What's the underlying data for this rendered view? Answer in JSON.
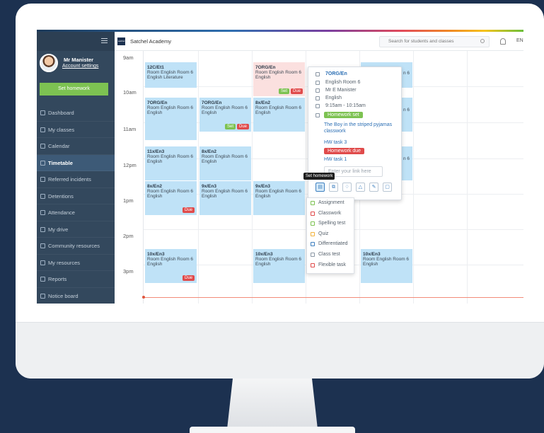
{
  "app": {
    "school": "Satchel Academy",
    "logo_text": "satchel",
    "lang": "EN"
  },
  "search": {
    "placeholder": "Search for students and classes"
  },
  "sidebar": {
    "user_name": "Mr Manister",
    "account_link": "Account settings",
    "set_homework": "Set homework",
    "items": [
      {
        "label": "Dashboard"
      },
      {
        "label": "My classes"
      },
      {
        "label": "Calendar"
      },
      {
        "label": "Timetable"
      },
      {
        "label": "Referred incidents"
      },
      {
        "label": "Detentions"
      },
      {
        "label": "Attendance"
      },
      {
        "label": "My drive"
      },
      {
        "label": "Community resources"
      },
      {
        "label": "My resources"
      },
      {
        "label": "Reports"
      },
      {
        "label": "Notice board"
      }
    ],
    "active_index": 3
  },
  "times": [
    "9am",
    "10am",
    "11am",
    "12pm",
    "1pm",
    "2pm",
    "3pm"
  ],
  "lessons": [
    {
      "title": "12C/Et1",
      "room": "Room English Room 6",
      "subject": "English Literature"
    },
    {
      "title": "7ORG/En",
      "room": "Room English Room 6",
      "subject": "English",
      "set": "Set",
      "due": "Due"
    },
    {
      "title": "7ORG/En",
      "room": "Room English Room 6",
      "subject": "English"
    },
    {
      "title": "7ORG/En",
      "room": "Room English Room 6",
      "subject": "English",
      "set": "Set",
      "due": "Due"
    },
    {
      "title": "8x/En2",
      "room": "Room English Room 6",
      "subject": "English"
    },
    {
      "title": "11x/En3",
      "room": "Room English Room 6",
      "subject": "English"
    },
    {
      "title": "8x/En2",
      "room": "Room English Room 6",
      "subject": "English"
    },
    {
      "title": "8x/En2",
      "room": "Room English Room 6",
      "subject": "English",
      "due": "Due"
    },
    {
      "title": "9x/En3",
      "room": "Room English Room 6",
      "subject": "English"
    },
    {
      "title": "9x/En3",
      "room": "Room English Room 6",
      "subject": "English"
    },
    {
      "title": "10x/En3",
      "room": "Room English Room 6",
      "subject": "English",
      "due": "Due"
    },
    {
      "title": "10x/En3",
      "room": "Room English Room 6",
      "subject": "English"
    },
    {
      "title": "10x/En3",
      "room": "Room English Room 6",
      "subject": "English"
    }
  ],
  "side_frag": {
    "a": "n 6",
    "b": "n 6",
    "c": "n 6"
  },
  "popup": {
    "title": "7ORG/En",
    "room": "English Room 6",
    "teacher": "Mr E Manister",
    "subject": "English",
    "time": "9:15am - 10:15am",
    "hw_set": "Homework set",
    "hw_set_title": "The Boy in the striped pyjamas classwork",
    "task3": "HW task 3",
    "hw_due": "Homework due",
    "task1": "HW task 1",
    "link_placeholder": "Enter your link here"
  },
  "tooltip": "Set homework",
  "menu": [
    "Assignment",
    "Classwork",
    "Spelling test",
    "Quiz",
    "Differentiated",
    "Class test",
    "Flexible task"
  ],
  "colors": {
    "lesson": "#bfe2f7",
    "sidebar": "#33485d",
    "green": "#7dc252",
    "red": "#e04b4b",
    "link": "#2c6fb4"
  }
}
